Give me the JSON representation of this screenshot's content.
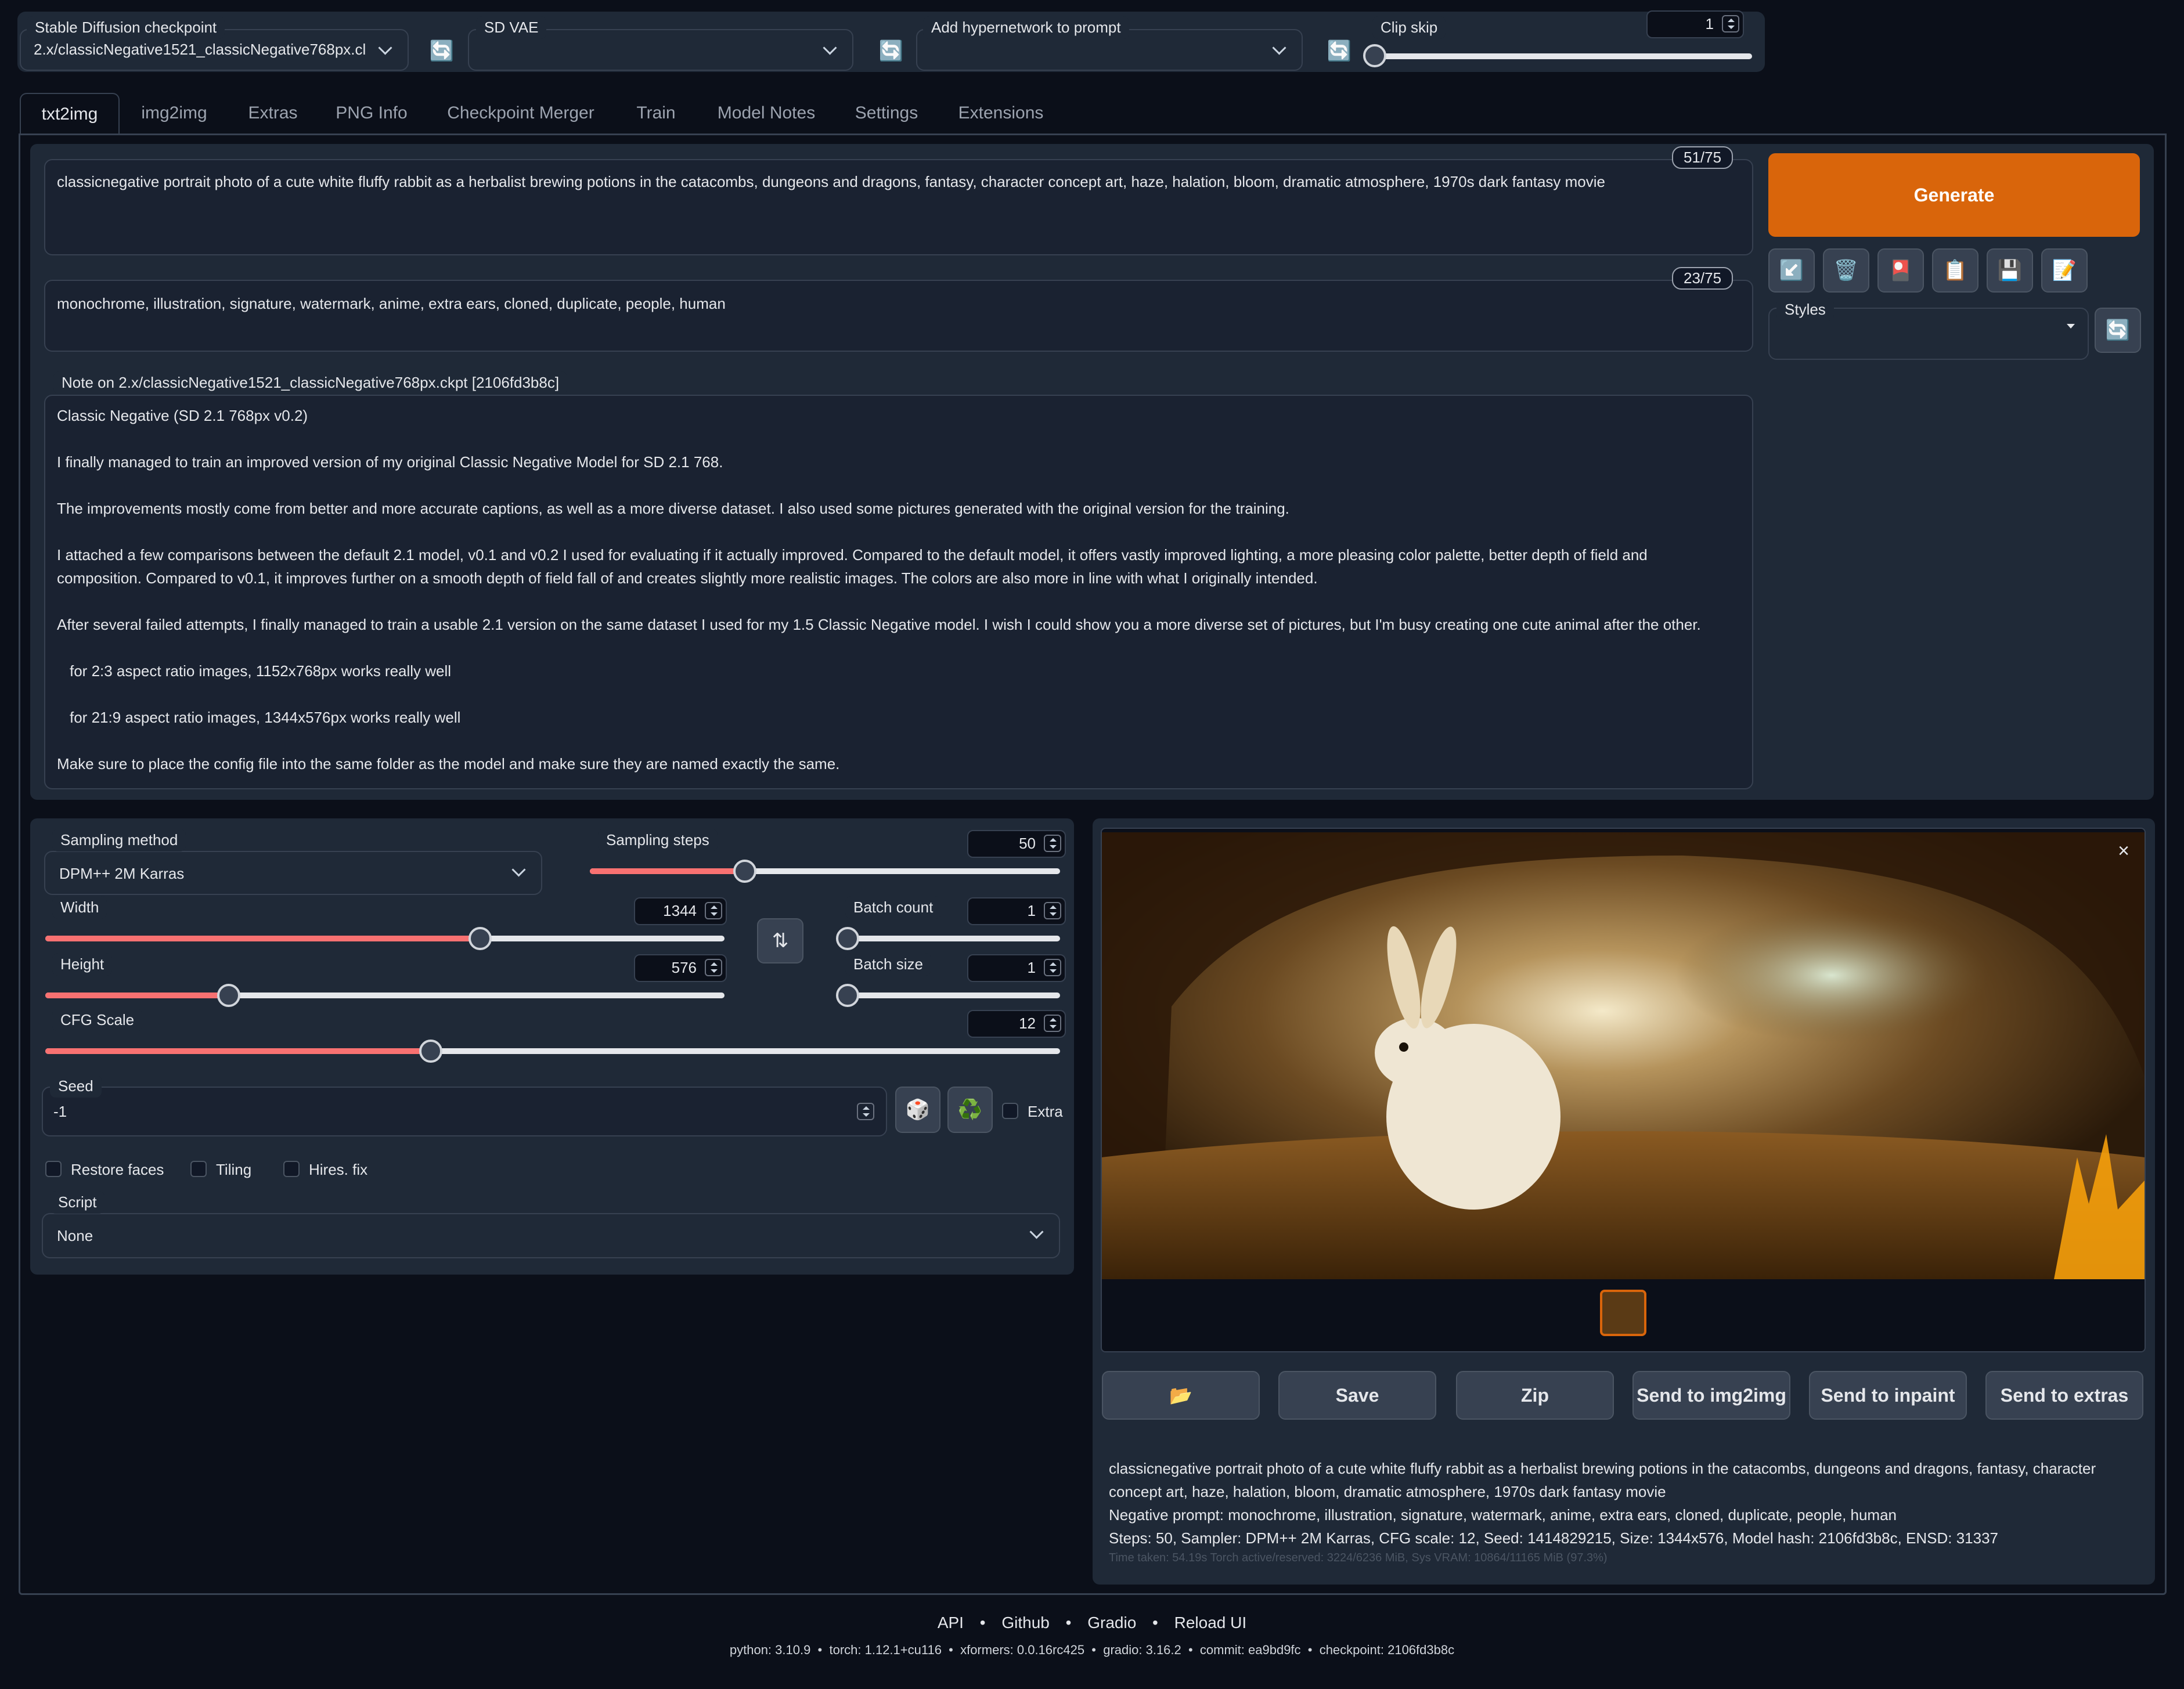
{
  "topbar": {
    "checkpoint_label": "Stable Diffusion checkpoint",
    "checkpoint_value": "2.x/classicNegative1521_classicNegative768px.cl",
    "vae_label": "SD VAE",
    "vae_value": "",
    "hypernet_label": "Add hypernetwork to prompt",
    "hypernet_value": "",
    "clipskip_label": "Clip skip",
    "clipskip_value": "1",
    "refresh_icon": "refresh-icon"
  },
  "tabs": [
    "txt2img",
    "img2img",
    "Extras",
    "PNG Info",
    "Checkpoint Merger",
    "Train",
    "Model Notes",
    "Settings",
    "Extensions"
  ],
  "prompt": {
    "text": "classicnegative portrait photo of a cute white fluffy rabbit as a herbalist brewing potions in the catacombs, dungeons and dragons, fantasy, character concept art, haze, halation, bloom, dramatic atmosphere, 1970s dark fantasy movie",
    "counter": "51/75"
  },
  "negative_prompt": {
    "text": "monochrome, illustration, signature, watermark, anime, extra ears, cloned, duplicate, people, human",
    "counter": "23/75"
  },
  "note": {
    "label": "Note on 2.x/classicNegative1521_classicNegative768px.ckpt [2106fd3b8c]",
    "lines": [
      "Classic Negative (SD 2.1 768px v0.2)",
      "I finally managed to train an improved version of my original Classic Negative Model for SD 2.1 768.",
      "The improvements mostly come from better and more accurate captions, as well as a more diverse dataset. I also used some pictures generated with the original version for the training.",
      "I attached a few comparisons between the default 2.1 model, v0.1 and v0.2 I used for evaluating if it actually improved. Compared to the default model, it offers vastly improved lighting, a more pleasing color palette, better depth of field and",
      "composition. Compared to v0.1, it improves further on a smooth depth of field fall of and creates slightly more realistic images. The colors are also more in line with what I originally intended.",
      "After several failed attempts, I finally managed to train a usable 2.1 version on the same dataset I used for my 1.5 Classic Negative model. I wish I could show you a more diverse set of pictures, but I'm busy creating one cute animal after the other.",
      "for 2:3 aspect ratio images, 1152x768px works really well",
      "for 21:9 aspect ratio images, 1344x576px works really well",
      "Make sure to place the config file into the same folder as the model and make sure they are named exactly the same."
    ]
  },
  "generate": {
    "label": "Generate",
    "color": "#d9650b",
    "tool_icons": [
      "↙️",
      "🗑️",
      "🎴",
      "📋",
      "💾",
      "📝"
    ],
    "styles_label": "Styles"
  },
  "params": {
    "sampling_method_label": "Sampling method",
    "sampling_method_value": "DPM++ 2M Karras",
    "sampling_steps_label": "Sampling steps",
    "sampling_steps_value": "50",
    "sampling_steps_fraction": 0.33,
    "width_label": "Width",
    "width_value": "1344",
    "width_fraction": 0.64,
    "height_label": "Height",
    "height_value": "576",
    "height_fraction": 0.27,
    "swap_icon": "⇅",
    "batch_count_label": "Batch count",
    "batch_count_value": "1",
    "batch_size_label": "Batch size",
    "batch_size_value": "1",
    "cfg_label": "CFG Scale",
    "cfg_value": "12",
    "cfg_fraction": 0.38,
    "seed_label": "Seed",
    "seed_value": "-1",
    "dice_icon": "🎲",
    "recycle_icon": "♻️",
    "extra_label": "Extra",
    "restore_faces_label": "Restore faces",
    "tiling_label": "Tiling",
    "hires_label": "Hires. fix",
    "script_label": "Script",
    "script_value": "None"
  },
  "output": {
    "close_icon": "×",
    "folder_icon": "📂",
    "buttons": [
      "Save",
      "Zip",
      "Send to img2img",
      "Send to inpaint",
      "Send to extras"
    ],
    "info_line1": "classicnegative portrait photo of a cute white fluffy rabbit as a herbalist brewing potions in the catacombs, dungeons and dragons, fantasy, character",
    "info_line2": "concept art, haze, halation, bloom, dramatic atmosphere, 1970s dark fantasy movie",
    "info_line3": "Negative prompt: monochrome, illustration, signature, watermark, anime, extra ears, cloned, duplicate, people, human",
    "info_line4": "Steps: 50, Sampler: DPM++ 2M Karras, CFG scale: 12, Seed: 1414829215, Size: 1344x576, Model hash: 2106fd3b8c, ENSD: 31337",
    "time_line": "Time taken: 54.19s  Torch active/reserved: 3224/6236 MiB, Sys VRAM: 10864/11165 MiB (97.3%)"
  },
  "footer": {
    "links": [
      "API",
      "Github",
      "Gradio",
      "Reload UI"
    ],
    "separator": "•",
    "versions": "python: 3.10.9  •  torch: 1.12.1+cu116  •  xformers: 0.0.16rc425  •  gradio: 3.16.2  •  commit: ea9bd9fc  •  checkpoint: 2106fd3b8c"
  }
}
